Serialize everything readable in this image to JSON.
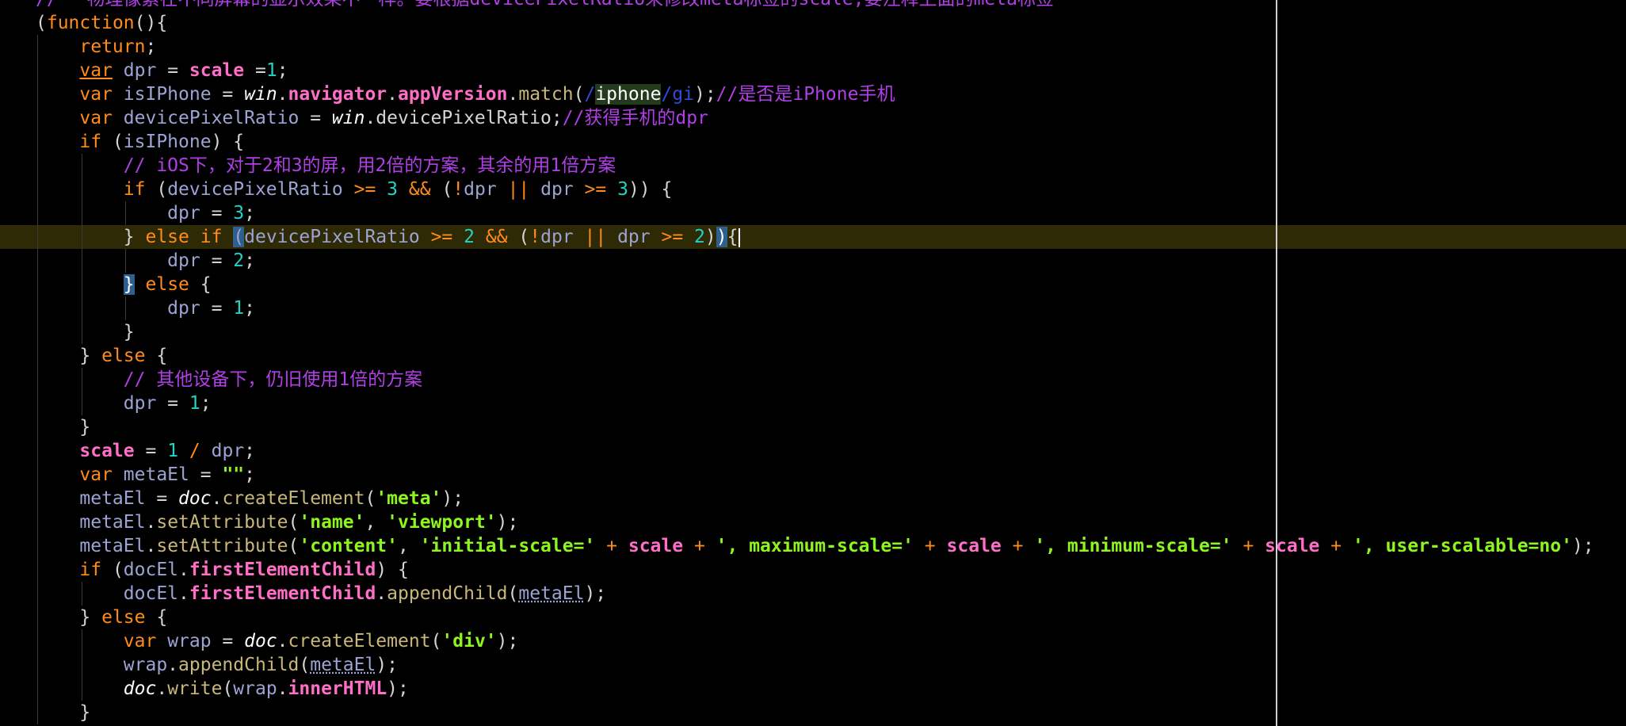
{
  "editor": {
    "theme_colors": {
      "background": "#000000",
      "keyword": "#ff8c1a",
      "property": "#ff6ec7",
      "string": "#8df51f",
      "comment": "#b13fe6",
      "number": "#21d3c6",
      "current_line": "#2d2a05",
      "bracket_match": "#2f5f8f"
    },
    "current_line_index": 10,
    "lines": [
      {
        "indent": 0,
        "tokens": [
          [
            "cmt",
            "// 一物理像素在不同屏幕的显示效果不一样。要根据devicePixelRatio来修改meta标签的scale,要注释上面的meta标签"
          ]
        ]
      },
      {
        "indent": 0,
        "tokens": [
          [
            "plain",
            "("
          ],
          [
            "kw",
            "function"
          ],
          [
            "plain",
            "(){"
          ]
        ]
      },
      {
        "indent": 1,
        "tokens": [
          [
            "kw",
            "return"
          ],
          [
            "plain",
            ";"
          ]
        ]
      },
      {
        "indent": 1,
        "tokens": [
          [
            "kw under",
            "var"
          ],
          [
            "plain",
            " "
          ],
          [
            "var",
            "dpr"
          ],
          [
            "plain",
            " = "
          ],
          [
            "prop",
            "scale"
          ],
          [
            "plain",
            " ="
          ],
          [
            "num",
            "1"
          ],
          [
            "plain",
            ";"
          ]
        ]
      },
      {
        "indent": 1,
        "tokens": [
          [
            "kw",
            "var"
          ],
          [
            "plain",
            " "
          ],
          [
            "var",
            "isIPhone"
          ],
          [
            "plain",
            " = "
          ],
          [
            "ital",
            "win"
          ],
          [
            "plain",
            "."
          ],
          [
            "prop",
            "navigator"
          ],
          [
            "plain",
            "."
          ],
          [
            "prop",
            "appVersion"
          ],
          [
            "plain",
            "."
          ],
          [
            "fn",
            "match"
          ],
          [
            "plain",
            "("
          ],
          [
            "re",
            "/"
          ],
          [
            "hlre",
            "iphone"
          ],
          [
            "re",
            "/gi"
          ],
          [
            "plain",
            ");"
          ],
          [
            "cmt",
            "//是否是iPhone手机"
          ]
        ]
      },
      {
        "indent": 1,
        "tokens": [
          [
            "kw",
            "var"
          ],
          [
            "plain",
            " "
          ],
          [
            "var",
            "devicePixelRatio"
          ],
          [
            "plain",
            " = "
          ],
          [
            "ital",
            "win"
          ],
          [
            "plain",
            ".devicePixelRatio;"
          ],
          [
            "cmt",
            "//获得手机的dpr"
          ]
        ]
      },
      {
        "indent": 1,
        "tokens": [
          [
            "kw",
            "if"
          ],
          [
            "plain",
            " ("
          ],
          [
            "var",
            "isIPhone"
          ],
          [
            "plain",
            ") {"
          ]
        ]
      },
      {
        "indent": 2,
        "tokens": [
          [
            "cmt",
            "// iOS下，对于2和3的屏，用2倍的方案，其余的用1倍方案"
          ]
        ]
      },
      {
        "indent": 2,
        "tokens": [
          [
            "kw",
            "if"
          ],
          [
            "plain",
            " ("
          ],
          [
            "var",
            "devicePixelRatio"
          ],
          [
            "plain",
            " "
          ],
          [
            "op",
            ">="
          ],
          [
            "plain",
            " "
          ],
          [
            "num",
            "3"
          ],
          [
            "plain",
            " "
          ],
          [
            "op",
            "&&"
          ],
          [
            "plain",
            " ("
          ],
          [
            "op",
            "!"
          ],
          [
            "var",
            "dpr"
          ],
          [
            "plain",
            " "
          ],
          [
            "op",
            "||"
          ],
          [
            "plain",
            " "
          ],
          [
            "var",
            "dpr"
          ],
          [
            "plain",
            " "
          ],
          [
            "op",
            ">="
          ],
          [
            "plain",
            " "
          ],
          [
            "num",
            "3"
          ],
          [
            "plain",
            ")) {"
          ]
        ]
      },
      {
        "indent": 3,
        "tokens": [
          [
            "var",
            "dpr"
          ],
          [
            "plain",
            " = "
          ],
          [
            "num",
            "3"
          ],
          [
            "plain",
            ";"
          ]
        ]
      },
      {
        "indent": 2,
        "tokens": [
          [
            "plain",
            "} "
          ],
          [
            "kw",
            "else if"
          ],
          [
            "plain",
            " "
          ],
          [
            "match",
            "("
          ],
          [
            "var",
            "devicePixelRatio"
          ],
          [
            "plain",
            " "
          ],
          [
            "op",
            ">="
          ],
          [
            "plain",
            " "
          ],
          [
            "num",
            "2"
          ],
          [
            "plain",
            " "
          ],
          [
            "op",
            "&&"
          ],
          [
            "plain",
            " ("
          ],
          [
            "op",
            "!"
          ],
          [
            "var",
            "dpr"
          ],
          [
            "plain",
            " "
          ],
          [
            "op",
            "||"
          ],
          [
            "plain",
            " "
          ],
          [
            "var",
            "dpr"
          ],
          [
            "plain",
            " "
          ],
          [
            "op",
            ">="
          ],
          [
            "plain",
            " "
          ],
          [
            "num",
            "2"
          ],
          [
            "plain",
            ")"
          ],
          [
            "match2",
            ")"
          ],
          [
            "plain",
            "{"
          ]
        ]
      },
      {
        "indent": 3,
        "tokens": [
          [
            "var",
            "dpr"
          ],
          [
            "plain",
            " = "
          ],
          [
            "num",
            "2"
          ],
          [
            "plain",
            ";"
          ]
        ]
      },
      {
        "indent": 2,
        "tokens": [
          [
            "match2",
            "}"
          ],
          [
            "plain",
            " "
          ],
          [
            "kw",
            "else"
          ],
          [
            "plain",
            " {"
          ]
        ]
      },
      {
        "indent": 3,
        "tokens": [
          [
            "var",
            "dpr"
          ],
          [
            "plain",
            " = "
          ],
          [
            "num",
            "1"
          ],
          [
            "plain",
            ";"
          ]
        ]
      },
      {
        "indent": 2,
        "tokens": [
          [
            "plain",
            "}"
          ]
        ]
      },
      {
        "indent": 1,
        "tokens": [
          [
            "plain",
            "} "
          ],
          [
            "kw",
            "else"
          ],
          [
            "plain",
            " {"
          ]
        ]
      },
      {
        "indent": 2,
        "tokens": [
          [
            "cmt",
            "// 其他设备下，仍旧使用1倍的方案"
          ]
        ]
      },
      {
        "indent": 2,
        "tokens": [
          [
            "var",
            "dpr"
          ],
          [
            "plain",
            " = "
          ],
          [
            "num",
            "1"
          ],
          [
            "plain",
            ";"
          ]
        ]
      },
      {
        "indent": 1,
        "tokens": [
          [
            "plain",
            "}"
          ]
        ]
      },
      {
        "indent": 1,
        "tokens": [
          [
            "prop",
            "scale"
          ],
          [
            "plain",
            " = "
          ],
          [
            "num",
            "1"
          ],
          [
            "plain",
            " "
          ],
          [
            "op",
            "/"
          ],
          [
            "plain",
            " "
          ],
          [
            "var",
            "dpr"
          ],
          [
            "plain",
            ";"
          ]
        ]
      },
      {
        "indent": 1,
        "tokens": [
          [
            "kw",
            "var"
          ],
          [
            "plain",
            " "
          ],
          [
            "var",
            "metaEl"
          ],
          [
            "plain",
            " = "
          ],
          [
            "str",
            "\"\""
          ],
          [
            "plain",
            ";"
          ]
        ]
      },
      {
        "indent": 1,
        "tokens": [
          [
            "var",
            "metaEl"
          ],
          [
            "plain",
            " = "
          ],
          [
            "ital",
            "doc"
          ],
          [
            "plain",
            "."
          ],
          [
            "fn",
            "createElement"
          ],
          [
            "plain",
            "("
          ],
          [
            "str",
            "'meta'"
          ],
          [
            "plain",
            ");"
          ]
        ]
      },
      {
        "indent": 1,
        "tokens": [
          [
            "var",
            "metaEl"
          ],
          [
            "plain",
            "."
          ],
          [
            "fn",
            "setAttribute"
          ],
          [
            "plain",
            "("
          ],
          [
            "str",
            "'name'"
          ],
          [
            "plain",
            ", "
          ],
          [
            "str",
            "'viewport'"
          ],
          [
            "plain",
            ");"
          ]
        ]
      },
      {
        "indent": 1,
        "tokens": [
          [
            "var",
            "metaEl"
          ],
          [
            "plain",
            "."
          ],
          [
            "fn",
            "setAttribute"
          ],
          [
            "plain",
            "("
          ],
          [
            "str",
            "'content'"
          ],
          [
            "plain",
            ", "
          ],
          [
            "str",
            "'initial-scale='"
          ],
          [
            "plain",
            " "
          ],
          [
            "op",
            "+"
          ],
          [
            "plain",
            " "
          ],
          [
            "prop",
            "scale"
          ],
          [
            "plain",
            " "
          ],
          [
            "op",
            "+"
          ],
          [
            "plain",
            " "
          ],
          [
            "str",
            "', maximum-scale='"
          ],
          [
            "plain",
            " "
          ],
          [
            "op",
            "+"
          ],
          [
            "plain",
            " "
          ],
          [
            "prop",
            "scale"
          ],
          [
            "plain",
            " "
          ],
          [
            "op",
            "+"
          ],
          [
            "plain",
            " "
          ],
          [
            "str",
            "', minimum-scale='"
          ],
          [
            "plain",
            " "
          ],
          [
            "op",
            "+"
          ],
          [
            "plain",
            " "
          ],
          [
            "prop",
            "scale"
          ],
          [
            "plain",
            " "
          ],
          [
            "op",
            "+"
          ],
          [
            "plain",
            " "
          ],
          [
            "str",
            "', user-scalable=no'"
          ],
          [
            "plain",
            ");"
          ]
        ]
      },
      {
        "indent": 1,
        "tokens": [
          [
            "kw",
            "if"
          ],
          [
            "plain",
            " ("
          ],
          [
            "var",
            "docEl"
          ],
          [
            "plain",
            "."
          ],
          [
            "prop",
            "firstElementChild"
          ],
          [
            "plain",
            ") {"
          ]
        ]
      },
      {
        "indent": 2,
        "tokens": [
          [
            "var",
            "docEl"
          ],
          [
            "plain",
            "."
          ],
          [
            "prop",
            "firstElementChild"
          ],
          [
            "plain",
            "."
          ],
          [
            "fn",
            "appendChild"
          ],
          [
            "plain",
            "("
          ],
          [
            "varund",
            "metaEl"
          ],
          [
            "plain",
            ");"
          ]
        ]
      },
      {
        "indent": 1,
        "tokens": [
          [
            "plain",
            "} "
          ],
          [
            "kw",
            "else"
          ],
          [
            "plain",
            " {"
          ]
        ]
      },
      {
        "indent": 2,
        "tokens": [
          [
            "kw",
            "var"
          ],
          [
            "plain",
            " "
          ],
          [
            "var",
            "wrap"
          ],
          [
            "plain",
            " = "
          ],
          [
            "ital",
            "doc"
          ],
          [
            "plain",
            "."
          ],
          [
            "fn",
            "createElement"
          ],
          [
            "plain",
            "("
          ],
          [
            "str",
            "'div'"
          ],
          [
            "plain",
            ");"
          ]
        ]
      },
      {
        "indent": 2,
        "tokens": [
          [
            "var",
            "wrap"
          ],
          [
            "plain",
            "."
          ],
          [
            "fn",
            "appendChild"
          ],
          [
            "plain",
            "("
          ],
          [
            "varund",
            "metaEl"
          ],
          [
            "plain",
            ");"
          ]
        ]
      },
      {
        "indent": 2,
        "tokens": [
          [
            "ital",
            "doc"
          ],
          [
            "plain",
            "."
          ],
          [
            "fn",
            "write"
          ],
          [
            "plain",
            "("
          ],
          [
            "var",
            "wrap"
          ],
          [
            "plain",
            "."
          ],
          [
            "prop",
            "innerHTML"
          ],
          [
            "plain",
            ");"
          ]
        ]
      },
      {
        "indent": 1,
        "tokens": [
          [
            "plain",
            "}"
          ]
        ]
      }
    ]
  }
}
